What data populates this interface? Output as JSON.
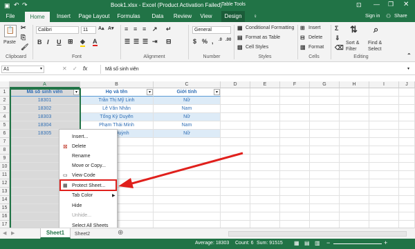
{
  "window": {
    "title": "Book1.xlsx - Excel (Product Activation Failed)",
    "context_tab_group": "Table Tools",
    "window_controls": [
      "minimize-icon",
      "restore-icon",
      "close-icon"
    ]
  },
  "ribbon_tabs": [
    "File",
    "Home",
    "Insert",
    "Page Layout",
    "Formulas",
    "Data",
    "Review",
    "View",
    "Design"
  ],
  "active_tab": "Home",
  "account": {
    "sign_in": "Sign in",
    "share": "Share"
  },
  "ribbon": {
    "clipboard": {
      "label": "Clipboard",
      "paste": "Paste"
    },
    "font": {
      "label": "Font",
      "name": "Calibri",
      "size": "11",
      "bold": "B",
      "italic": "I",
      "underline": "U"
    },
    "alignment": {
      "label": "Alignment"
    },
    "number": {
      "label": "Number",
      "format": "General",
      "currency": "$",
      "percent": "%",
      "comma": ","
    },
    "styles": {
      "label": "Styles",
      "conditional": "Conditional Formatting",
      "format_table": "Format as Table",
      "cell_styles": "Cell Styles"
    },
    "cells": {
      "label": "Cells",
      "insert": "Insert",
      "delete": "Delete",
      "format": "Format"
    },
    "editing": {
      "label": "Editing",
      "sort_filter": "Sort & Filter",
      "find_select": "Find & Select"
    }
  },
  "formula_bar": {
    "name_box": "A1",
    "fx": "fx",
    "content": "Mã số sinh viên"
  },
  "columns": [
    "A",
    "B",
    "C",
    "D",
    "E",
    "F",
    "G",
    "H",
    "I",
    "J"
  ],
  "rows": [
    "1",
    "2",
    "3",
    "4",
    "5",
    "6",
    "7",
    "8",
    "9",
    "10",
    "11",
    "12",
    "13",
    "14",
    "15",
    "16",
    "17"
  ],
  "table": {
    "headers": [
      "Mã số sinh viên",
      "Họ và tên",
      "Giới tính"
    ],
    "rows": [
      [
        "18301",
        "Trần Thị Mỹ Linh",
        "Nữ"
      ],
      [
        "18302",
        "Lê Văn Nhân",
        "Nam"
      ],
      [
        "18303",
        "Tống Kỳ Duyên",
        "Nữ"
      ],
      [
        "18304",
        "Phạm Thái Minh",
        "Nam"
      ],
      [
        "18305",
        "Như Quỳnh",
        "Nữ"
      ]
    ]
  },
  "context_menu": [
    {
      "label": "Insert...",
      "disabled": false
    },
    {
      "label": "Delete",
      "disabled": false
    },
    {
      "label": "Rename",
      "disabled": false
    },
    {
      "label": "Move or Copy...",
      "disabled": false
    },
    {
      "label": "View Code",
      "disabled": false
    },
    {
      "label": "Protect Sheet...",
      "disabled": false
    },
    {
      "label": "Tab Color",
      "disabled": false
    },
    {
      "label": "Hide",
      "disabled": false
    },
    {
      "label": "Unhide...",
      "disabled": true
    },
    {
      "label": "Select All Sheets",
      "disabled": false
    }
  ],
  "sheet_tabs": [
    "Sheet1",
    "Sheet2"
  ],
  "status": {
    "average": "Average: 18303",
    "count": "Count: 6",
    "sum": "Sum: 91515"
  },
  "colors": {
    "brand": "#217346",
    "highlight": "#e0201c",
    "table_header_text": "#2f6eb5",
    "table_band": "#ddebf7"
  }
}
